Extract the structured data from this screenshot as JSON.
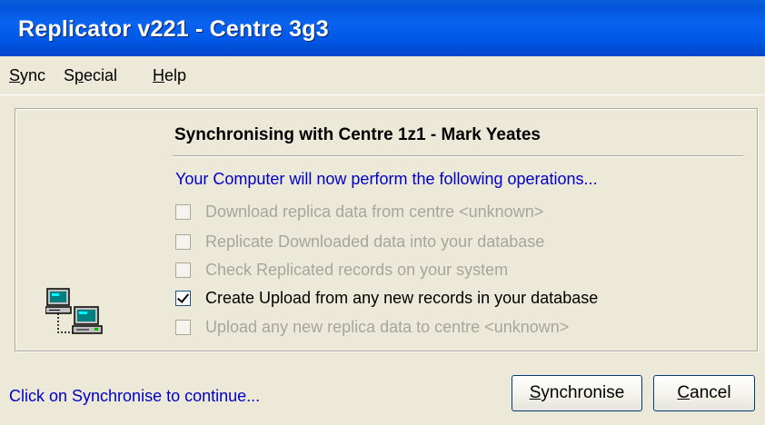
{
  "window": {
    "title": "Replicator v221 - Centre 3g3"
  },
  "menu": [
    {
      "label": "Sync",
      "accel": "S",
      "rest": "ync"
    },
    {
      "label": "Special",
      "accel_pre": "S",
      "accel": "p",
      "rest": "ecial"
    },
    {
      "label": "Help",
      "accel": "H",
      "rest": "elp"
    }
  ],
  "panel": {
    "heading": "Synchronising with Centre 1z1 - Mark Yeates",
    "intro": "Your Computer will now perform the following operations...",
    "operations": [
      {
        "label": "Download replica data from centre <unknown>",
        "checked": false,
        "enabled": false
      },
      {
        "label": "Replicate Downloaded data into your database",
        "checked": false,
        "enabled": false
      },
      {
        "label": "Check Replicated records on your system",
        "checked": false,
        "enabled": false
      },
      {
        "label": "Create Upload from any new records in your database",
        "checked": true,
        "enabled": true
      },
      {
        "label": "Upload any new replica data to centre <unknown>",
        "checked": false,
        "enabled": false
      }
    ],
    "icon": "network-computers-icon"
  },
  "status": "Click on Synchronise to continue...",
  "buttons": {
    "synchronise": {
      "label": "Synchronise",
      "accel": "S",
      "rest": "ynchronise"
    },
    "cancel": {
      "label": "Cancel",
      "accel": "C",
      "rest": "ancel"
    }
  },
  "colors": {
    "title_bar": "#0058e6",
    "window_bg": "#ece9d8",
    "info_text": "#0000c8",
    "disabled_text": "#a7a69b"
  }
}
